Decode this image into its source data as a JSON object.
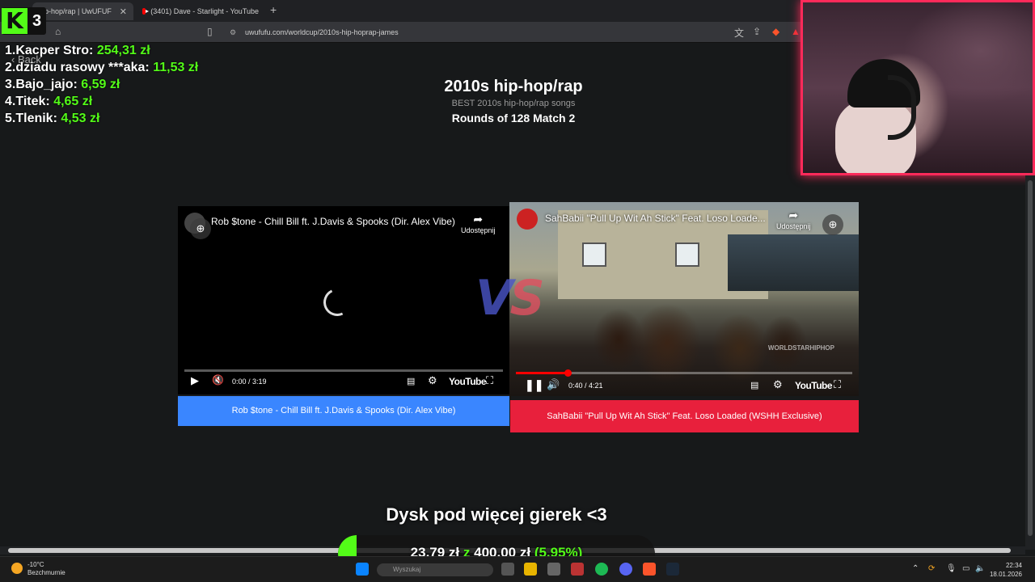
{
  "browser": {
    "tabs": [
      {
        "label": "hip-hop/rap | UwUFUF",
        "active": true
      },
      {
        "label": "(3401) Dave - Starlight - YouTube",
        "active": false
      }
    ],
    "url": "uwufufu.com/worldcup/2010s-hip-hoprap-james"
  },
  "kick_badge": {
    "letter": "K",
    "number": "3"
  },
  "leaderboard": [
    {
      "rank_name": "1.Kacper Stro:",
      "amount": "254,31 zł"
    },
    {
      "rank_name": "2.dziadu rasowy ***aka:",
      "amount": "11,53 zł"
    },
    {
      "rank_name": "3.Bajo_jajo:",
      "amount": "6,59 zł"
    },
    {
      "rank_name": "4.Titek:",
      "amount": "4,65 zł"
    },
    {
      "rank_name": "5.Tlenik:",
      "amount": "4,53 zł"
    }
  ],
  "page": {
    "back_label": "Back",
    "title": "2010s hip-hop/rap",
    "subtitle": "BEST 2010s hip-hop/rap songs",
    "round_info": "Rounds of 128 Match 2",
    "vs_v": "V",
    "vs_s": "S"
  },
  "left_video": {
    "title": "Rob $tone - Chill Bill ft. J.Davis & Spooks (Dir. Alex Vibe)",
    "time": "0:00 / 3:19",
    "progress": 0.0,
    "state": "loading",
    "share_label": "Udostępnij",
    "youtube_label": "YouTube",
    "choice_label": "Rob $tone - Chill Bill ft. J.Davis & Spooks (Dir. Alex Vibe)",
    "choice_color": "#3a86ff"
  },
  "right_video": {
    "title": "SahBabii \"Pull Up Wit Ah Stick\" Feat. Loso Loade...",
    "time": "0:40 / 4:21",
    "progress": 0.153,
    "state": "playing",
    "share_label": "Udostępnij",
    "youtube_label": "YouTube",
    "watermark": "WORLDSTARHIPHOP",
    "choice_label": "SahBabii \"Pull Up Wit Ah Stick\" Feat. Loso Loaded (WSHH Exclusive)",
    "choice_color": "#e8203c"
  },
  "goal": {
    "title": "Dysk pod więcej gierek <3",
    "current": "23,79 zł",
    "separator": "z",
    "target": "400,00 zł",
    "percent_label": "(5.95%)",
    "fraction": 0.0595
  },
  "taskbar": {
    "weather_temp": "-10°C",
    "weather_desc": "Bezchmurnie",
    "search_placeholder": "Wyszukaj",
    "time": "22:34",
    "date": "18.01.2026"
  },
  "colors": {
    "accent_green": "#53fc18",
    "webcam_border": "#ff2a5a",
    "left_choice": "#3a86ff",
    "right_choice": "#e8203c"
  }
}
